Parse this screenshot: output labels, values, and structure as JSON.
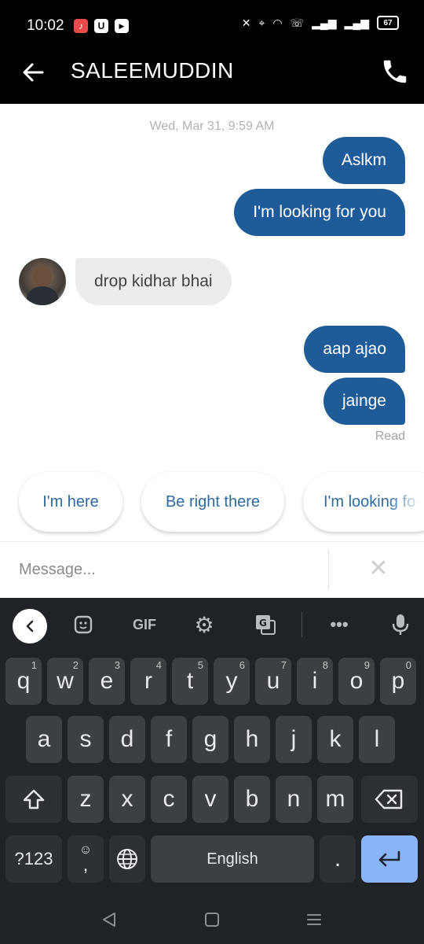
{
  "status_bar": {
    "time": "10:02",
    "battery": "67"
  },
  "header": {
    "title": "SALEEMUDDIN"
  },
  "chat": {
    "timestamp": "Wed, Mar 31, 9:59 AM",
    "messages": [
      {
        "text": "Aslkm"
      },
      {
        "text": "I'm looking for you"
      },
      {
        "text": "drop kidhar bhai"
      },
      {
        "text": "aap ajao"
      },
      {
        "text": "jainge"
      }
    ],
    "read_label": "Read"
  },
  "quick_replies": [
    "I'm here",
    "Be right there",
    "I'm looking fo"
  ],
  "composer": {
    "placeholder": "Message..."
  },
  "keyboard": {
    "toolbar": {
      "gif": "GIF"
    },
    "row1": [
      "q",
      "w",
      "e",
      "r",
      "t",
      "y",
      "u",
      "i",
      "o",
      "p"
    ],
    "row1_hints": [
      "1",
      "2",
      "3",
      "4",
      "5",
      "6",
      "7",
      "8",
      "9",
      "0"
    ],
    "row2": [
      "a",
      "s",
      "d",
      "f",
      "g",
      "h",
      "j",
      "k",
      "l"
    ],
    "row3": [
      "z",
      "x",
      "c",
      "v",
      "b",
      "n",
      "m"
    ],
    "symbols_label": "?123",
    "comma": ",",
    "space_label": "English",
    "period": "."
  }
}
